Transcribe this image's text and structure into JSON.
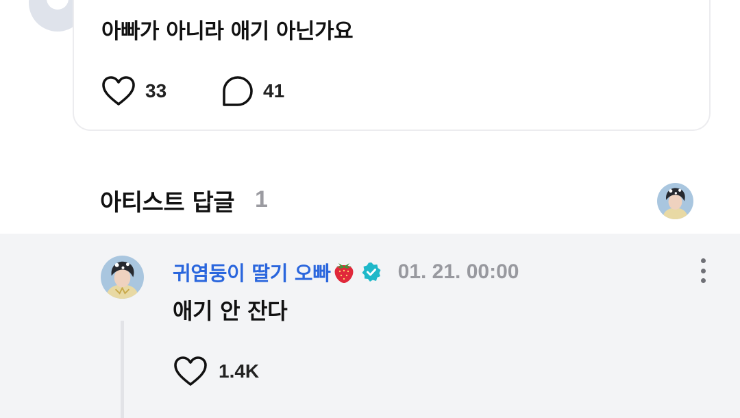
{
  "post": {
    "text": "아빠가 아니라 애기 아닌가요",
    "likes": "33",
    "comments": "41"
  },
  "artist_replies": {
    "title": "아티스트 답글",
    "count": "1"
  },
  "reply": {
    "author": "귀염둥이 딸기 오빠",
    "time": "01. 21. 00:00",
    "text": "애기 안 잔다",
    "likes": "1.4K"
  },
  "colors": {
    "author_blue": "#2a66dd",
    "verified_teal": "#1fb8c9",
    "muted_gray": "#98999f",
    "reply_bg": "#f3f4f6"
  },
  "icons": {
    "like": "heart-outline-icon",
    "comment": "speech-bubble-icon",
    "verified": "verified-badge-icon",
    "emoji": "strawberry-icon",
    "more": "vertical-ellipsis-icon"
  }
}
